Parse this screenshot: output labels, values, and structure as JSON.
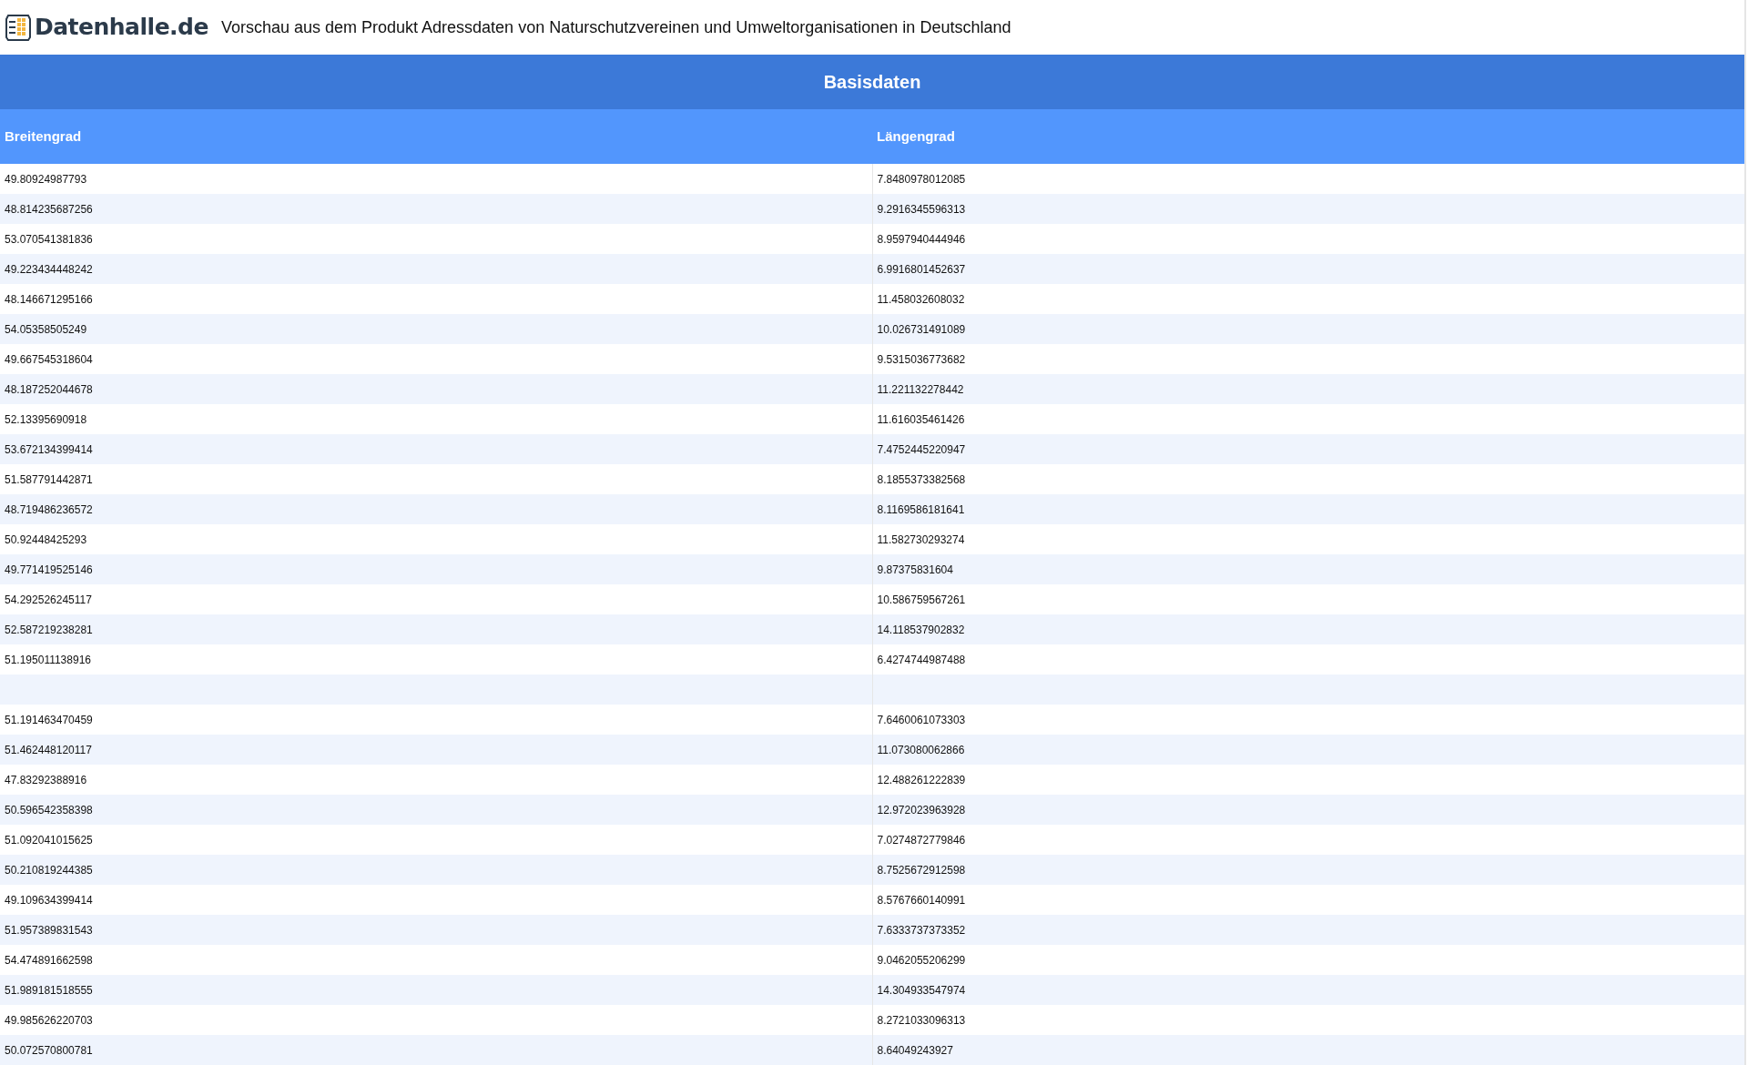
{
  "header": {
    "logo_text": "Datenhalle.de",
    "title": "Vorschau aus dem Produkt Adressdaten von Naturschutzvereinen und Umweltorganisationen in Deutschland"
  },
  "table": {
    "caption": "Basisdaten",
    "columns": [
      "Breitengrad",
      "Längengrad"
    ],
    "rows": [
      [
        "49.80924987793",
        "7.8480978012085"
      ],
      [
        "48.814235687256",
        "9.2916345596313"
      ],
      [
        "53.070541381836",
        "8.9597940444946"
      ],
      [
        "49.223434448242",
        "6.9916801452637"
      ],
      [
        "48.146671295166",
        "11.458032608032"
      ],
      [
        "54.05358505249",
        "10.026731491089"
      ],
      [
        "49.667545318604",
        "9.5315036773682"
      ],
      [
        "48.187252044678",
        "11.221132278442"
      ],
      [
        "52.13395690918",
        "11.616035461426"
      ],
      [
        "53.672134399414",
        "7.4752445220947"
      ],
      [
        "51.587791442871",
        "8.1855373382568"
      ],
      [
        "48.719486236572",
        "8.1169586181641"
      ],
      [
        "50.92448425293",
        "11.582730293274"
      ],
      [
        "49.771419525146",
        "9.87375831604"
      ],
      [
        "54.292526245117",
        "10.586759567261"
      ],
      [
        "52.587219238281",
        "14.118537902832"
      ],
      [
        "51.195011138916",
        "6.4274744987488"
      ],
      [],
      [
        "51.191463470459",
        "7.6460061073303"
      ],
      [
        "51.462448120117",
        "11.073080062866"
      ],
      [
        "47.83292388916",
        "12.488261222839"
      ],
      [
        "50.596542358398",
        "12.972023963928"
      ],
      [
        "51.092041015625",
        "7.0274872779846"
      ],
      [
        "50.210819244385",
        "8.7525672912598"
      ],
      [
        "49.109634399414",
        "8.5767660140991"
      ],
      [
        "51.957389831543",
        "7.6333737373352"
      ],
      [
        "54.474891662598",
        "9.0462055206299"
      ],
      [
        "51.989181518555",
        "14.304933547974"
      ],
      [
        "49.985626220703",
        "8.2721033096313"
      ],
      [
        "50.072570800781",
        "8.64049243927"
      ]
    ]
  }
}
